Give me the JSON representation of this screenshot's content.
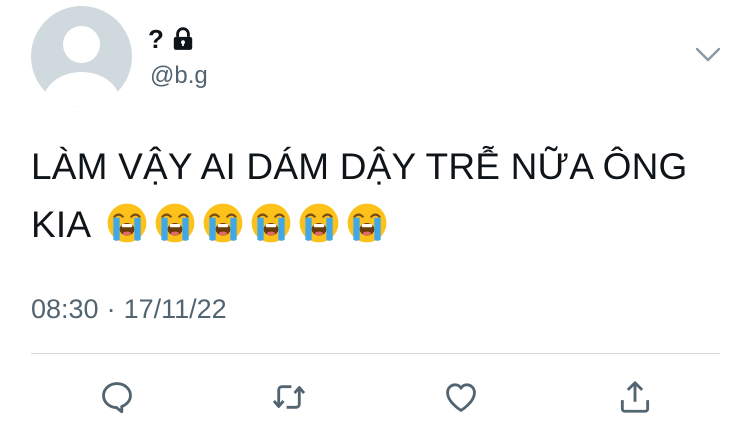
{
  "author": {
    "display_name": "?",
    "handle": "@b.g",
    "locked": true
  },
  "tweet": {
    "text": "LÀM VẬY AI DÁM DẬY TRỄ NỮA ÔNG KIA",
    "emojis": [
      "loudly-crying-face",
      "loudly-crying-face",
      "loudly-crying-face",
      "loudly-crying-face",
      "loudly-crying-face",
      "loudly-crying-face"
    ]
  },
  "meta": {
    "time": "08:30",
    "separator": "·",
    "date": "17/11/22"
  },
  "actions": [
    "reply-icon",
    "retweet-icon",
    "like-icon",
    "share-icon"
  ],
  "colors": {
    "text": "#0f1419",
    "secondary": "#536471",
    "divider": "#cfd9de",
    "avatar_bg": "#cfd9de",
    "emoji_face": "#fcc21b",
    "emoji_tears": "#40a7e8"
  }
}
